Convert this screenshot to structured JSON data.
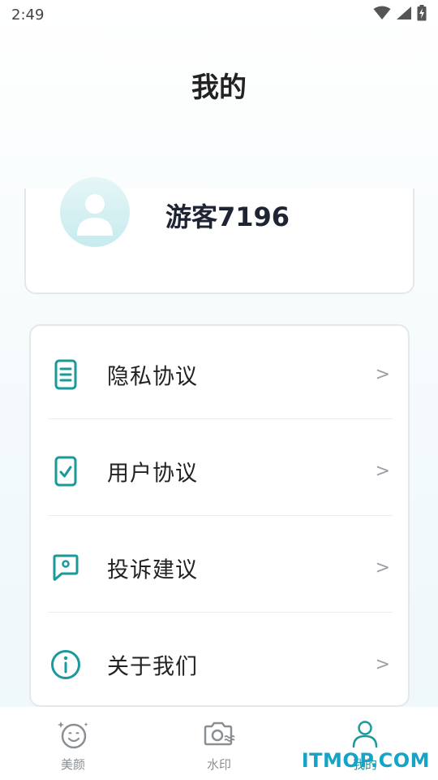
{
  "status_bar": {
    "time": "2:49",
    "icons": [
      "wifi-icon",
      "signal-icon",
      "battery-charging-icon"
    ]
  },
  "header": {
    "title": "我的"
  },
  "profile": {
    "username": "游客7196",
    "avatar_icon": "user-avatar-icon"
  },
  "menu": {
    "items": [
      {
        "label": "隐私协议",
        "icon": "document-icon",
        "chevron": ">"
      },
      {
        "label": "用户协议",
        "icon": "checklist-icon",
        "chevron": ">"
      },
      {
        "label": "投诉建议",
        "icon": "feedback-icon",
        "chevron": ">"
      },
      {
        "label": "关于我们",
        "icon": "info-icon",
        "chevron": ">"
      }
    ]
  },
  "tab_bar": {
    "tabs": [
      {
        "label": "美颜",
        "icon": "beauty-face-icon",
        "active": false
      },
      {
        "label": "水印",
        "icon": "camera-watermark-icon",
        "active": false
      },
      {
        "label": "我的",
        "icon": "person-icon",
        "active": true
      }
    ]
  },
  "site_watermark": "ITMOP.COM",
  "colors": {
    "accent": "#1a9a9a",
    "text_primary": "#222222",
    "text_secondary": "#8a8f94",
    "watermark": "#15a4c6"
  }
}
